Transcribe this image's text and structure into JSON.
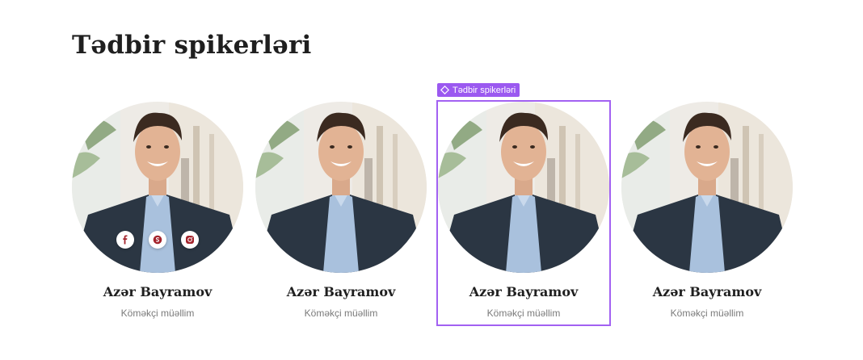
{
  "section": {
    "title": "Tədbir spikerləri"
  },
  "component_tag": {
    "label": "Tədbir spikerləri"
  },
  "colors": {
    "selection": "#a261f2",
    "social_icon": "#a3232c"
  },
  "speakers": [
    {
      "name": "Azər Bayramov",
      "role": "Köməkçi müəllim",
      "socials": [
        "facebook-icon",
        "skype-icon",
        "instagram-icon"
      ]
    },
    {
      "name": "Azər Bayramov",
      "role": "Köməkçi müəllim"
    },
    {
      "name": "Azər Bayramov",
      "role": "Köməkçi müəllim",
      "selected": true
    },
    {
      "name": "Azər Bayramov",
      "role": "Köməkçi müəllim"
    }
  ]
}
